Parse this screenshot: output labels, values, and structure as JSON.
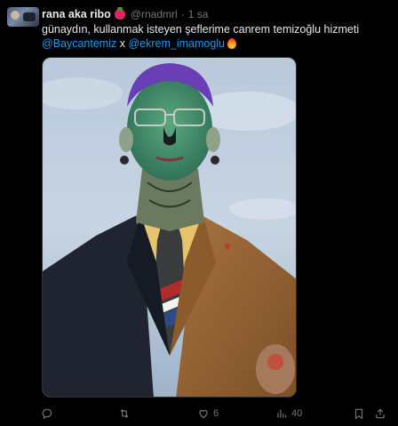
{
  "tweet": {
    "author_name": "rana aka ribo",
    "name_emoji": "strawberry-emoji",
    "handle": "@rnadmrl",
    "separator": "·",
    "time": "1 sa",
    "more_label": "···",
    "text_line1": "günaydın, kullanmak isteyen şeflerime canrem temizoğlu hizmeti",
    "mention1": "@Baycantemiz",
    "connector": " x ",
    "mention2": "@ekrem_imamoglu",
    "end_emoji": "fire-emoji"
  },
  "actions": {
    "reply_count": "",
    "retweet_count": "",
    "like_count": "6",
    "views_count": "40"
  },
  "icons": [
    "reply-icon",
    "retweet-icon",
    "like-icon",
    "views-icon",
    "bookmark-icon",
    "share-icon"
  ],
  "colors": {
    "background": "#000000",
    "text": "#e7e9ea",
    "muted": "#71767b",
    "link": "#1d9bf0"
  }
}
